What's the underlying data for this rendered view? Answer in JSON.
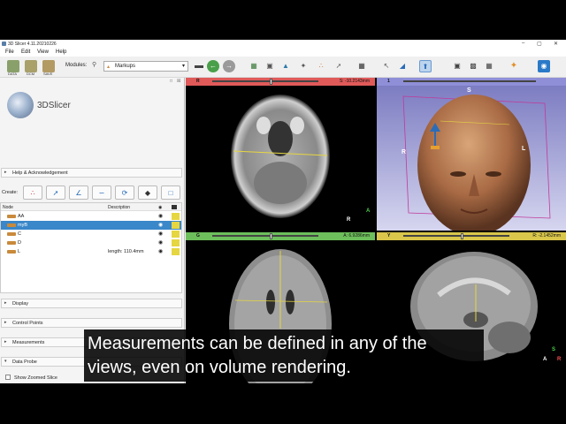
{
  "window": {
    "title": "3D Slicer 4.11.20210226",
    "controls": [
      "–",
      "▢",
      "✕"
    ]
  },
  "menu": [
    "File",
    "Edit",
    "View",
    "Help"
  ],
  "toolbar": {
    "data_label": "DATA",
    "dcm_label": "DCM",
    "save_label": "SAVE",
    "modules_label": "Modules:",
    "module_value": "Markups"
  },
  "panel": {
    "logo_text": "3DSlicer",
    "help_section": "Help & Acknowledgement",
    "create_label": "Create:",
    "tree_headers": {
      "node": "Node",
      "description": "Description"
    },
    "nodes": [
      {
        "name": "AA",
        "description": "",
        "selected": false
      },
      {
        "name": "myB",
        "description": "",
        "selected": true
      },
      {
        "name": "C",
        "description": "",
        "selected": false
      },
      {
        "name": "D",
        "description": "",
        "selected": false
      },
      {
        "name": "L",
        "description": "length: 110.4mm",
        "selected": false
      }
    ],
    "sections": [
      "Display",
      "Control Points",
      "Measurements",
      "Data Probe"
    ],
    "show_zoomed": "Show Zoomed Slice",
    "probe_letters": [
      "L",
      "F",
      "B"
    ]
  },
  "views": {
    "red": {
      "letter": "R",
      "offset": "S: -10.2143mm",
      "color": "#e05a5a"
    },
    "threed": {
      "letter": "1",
      "color": "#8f8fd8"
    },
    "green": {
      "letter": "G",
      "offset": "A: 6.9286mm",
      "color": "#6dbf5b"
    },
    "yellow": {
      "letter": "Y",
      "offset": "R: -2.1452mm",
      "color": "#d9c64a"
    }
  },
  "orientation": {
    "S": "S",
    "R": "R",
    "L": "L",
    "A": "A"
  },
  "subtitle": {
    "line1": "Measurements can be defined in any of the",
    "line2": "views, even on volume rendering."
  }
}
